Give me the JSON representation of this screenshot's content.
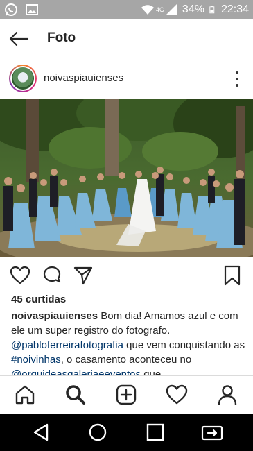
{
  "status_bar": {
    "battery": "34%",
    "time": "22:34",
    "network": "4G",
    "left_icons": [
      "whatsapp-icon",
      "image-icon"
    ],
    "right_icons": [
      "wifi-icon",
      "signal-icon",
      "battery-icon"
    ]
  },
  "app_bar": {
    "title": "Foto",
    "back_icon": "arrow-left-icon"
  },
  "post": {
    "username": "noivaspiauienses",
    "photo_description": "",
    "likes": "45 curtidas",
    "caption": {
      "username": "noivaspiauienses",
      "text_1": " Bom dia! Amamos azul e com ele um super registro do fotografo. ",
      "mention_1": "@pabloferreirafotografia",
      "text_2": " que vem conquistando as ",
      "hashtag_1": "#noivinhas",
      "text_3": ", o casamento aconteceu no ",
      "mention_2": "@orquideasgaleriaeeventos",
      "text_4": " que"
    },
    "actions": [
      "heart-icon",
      "comment-icon",
      "share-icon",
      "bookmark-icon"
    ]
  },
  "tab_bar": {
    "items": [
      "home-icon",
      "search-icon",
      "add-icon",
      "activity-icon",
      "profile-icon"
    ],
    "active": "search-icon"
  },
  "nav_bar": {
    "items": [
      "back-triangle-icon",
      "home-circle-icon",
      "recents-square-icon",
      "screen-mirror-icon"
    ]
  },
  "colors": {
    "status_bar_bg": "#a6a6a6",
    "link": "#003569",
    "text": "#262626",
    "navbar_bg": "#000000"
  }
}
